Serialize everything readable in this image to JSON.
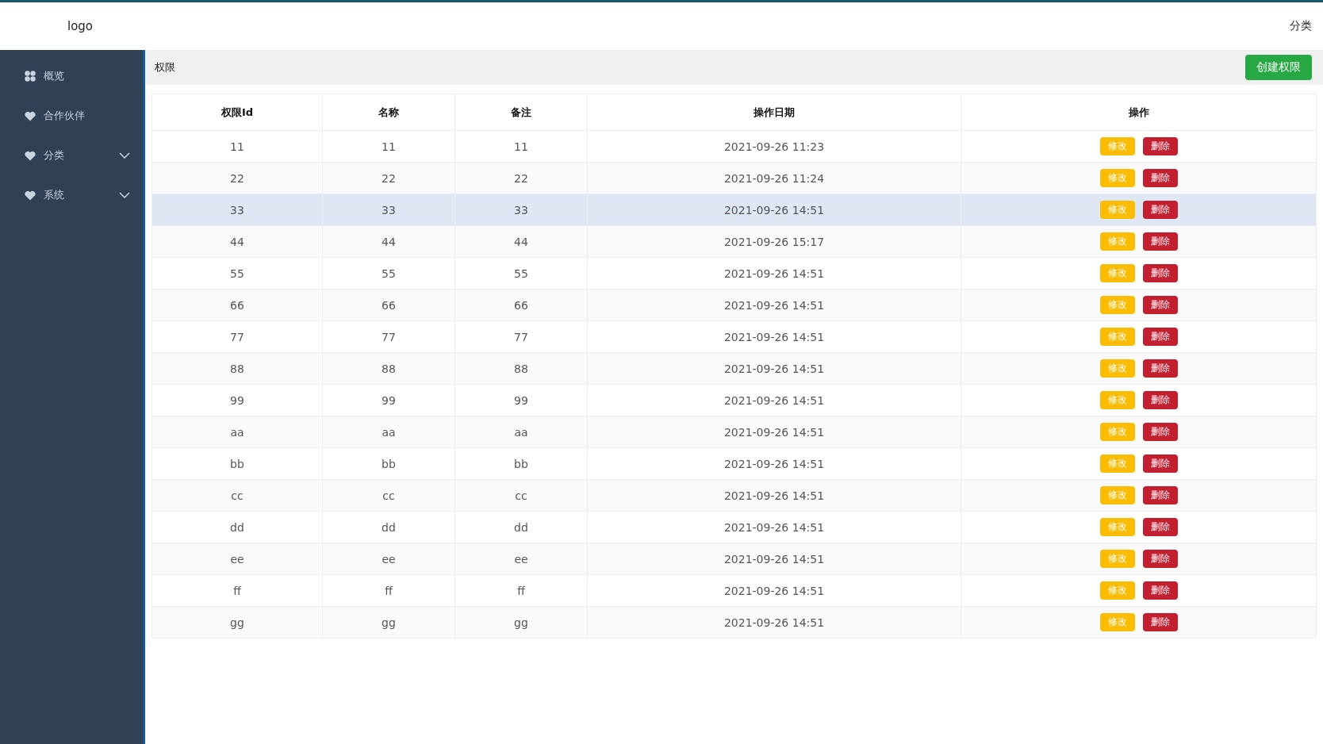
{
  "header": {
    "logo": "logo",
    "right_link": "分类"
  },
  "sidebar": {
    "items": [
      {
        "label": "概览",
        "kind": "link"
      },
      {
        "label": "合作伙伴",
        "kind": "link"
      },
      {
        "label": "分类",
        "kind": "group"
      },
      {
        "label": "系统",
        "kind": "group"
      }
    ]
  },
  "breadcrumb": "权限",
  "create_button": "创建权限",
  "table": {
    "columns": [
      "权限Id",
      "名称",
      "备注",
      "操作日期",
      "操作"
    ],
    "rows": [
      {
        "cells": [
          "11",
          "11",
          "11",
          "2021-09-26 11:23"
        ],
        "highlighted": false,
        "actions": [
          {
            "kind": "edit",
            "label": "修改"
          },
          {
            "kind": "delete",
            "label": "删除"
          }
        ]
      },
      {
        "cells": [
          "22",
          "22",
          "22",
          "2021-09-26 11:24"
        ],
        "highlighted": false,
        "actions": [
          {
            "kind": "edit",
            "label": "修改"
          },
          {
            "kind": "delete",
            "label": "删除"
          }
        ]
      },
      {
        "cells": [
          "33",
          "33",
          "33",
          "2021-09-26 14:51"
        ],
        "highlighted": true,
        "actions": [
          {
            "kind": "edit",
            "label": "修改"
          },
          {
            "kind": "delete",
            "label": "删除"
          }
        ]
      },
      {
        "cells": [
          "44",
          "44",
          "44",
          "2021-09-26 15:17"
        ],
        "highlighted": false,
        "actions": [
          {
            "kind": "edit",
            "label": "修改"
          },
          {
            "kind": "delete",
            "label": "删除"
          }
        ]
      },
      {
        "cells": [
          "55",
          "55",
          "55",
          "2021-09-26 14:51"
        ],
        "highlighted": false,
        "actions": [
          {
            "kind": "edit",
            "label": "修改"
          },
          {
            "kind": "delete",
            "label": "删除"
          }
        ]
      },
      {
        "cells": [
          "66",
          "66",
          "66",
          "2021-09-26 14:51"
        ],
        "highlighted": false,
        "actions": [
          {
            "kind": "edit",
            "label": "修改"
          },
          {
            "kind": "delete",
            "label": "删除"
          }
        ]
      },
      {
        "cells": [
          "77",
          "77",
          "77",
          "2021-09-26 14:51"
        ],
        "highlighted": false,
        "actions": [
          {
            "kind": "edit",
            "label": "修改"
          },
          {
            "kind": "delete",
            "label": "删除"
          }
        ]
      },
      {
        "cells": [
          "88",
          "88",
          "88",
          "2021-09-26 14:51"
        ],
        "highlighted": false,
        "actions": [
          {
            "kind": "edit",
            "label": "修改"
          },
          {
            "kind": "delete",
            "label": "删除"
          }
        ]
      },
      {
        "cells": [
          "99",
          "99",
          "99",
          "2021-09-26 14:51"
        ],
        "highlighted": false,
        "actions": [
          {
            "kind": "edit",
            "label": "修改"
          },
          {
            "kind": "delete",
            "label": "删除"
          }
        ]
      },
      {
        "cells": [
          "aa",
          "aa",
          "aa",
          "2021-09-26 14:51"
        ],
        "highlighted": false,
        "actions": [
          {
            "kind": "edit",
            "label": "修改"
          },
          {
            "kind": "delete",
            "label": "删除"
          }
        ]
      },
      {
        "cells": [
          "bb",
          "bb",
          "bb",
          "2021-09-26 14:51"
        ],
        "highlighted": false,
        "actions": [
          {
            "kind": "edit",
            "label": "修改"
          },
          {
            "kind": "delete",
            "label": "删除"
          }
        ]
      },
      {
        "cells": [
          "cc",
          "cc",
          "cc",
          "2021-09-26 14:51"
        ],
        "highlighted": false,
        "actions": [
          {
            "kind": "edit",
            "label": "修改"
          },
          {
            "kind": "delete",
            "label": "删除"
          }
        ]
      },
      {
        "cells": [
          "dd",
          "dd",
          "dd",
          "2021-09-26 14:51"
        ],
        "highlighted": false,
        "actions": [
          {
            "kind": "edit",
            "label": "修改"
          },
          {
            "kind": "delete",
            "label": "删除"
          }
        ]
      },
      {
        "cells": [
          "ee",
          "ee",
          "ee",
          "2021-09-26 14:51"
        ],
        "highlighted": false,
        "actions": [
          {
            "kind": "edit",
            "label": "修改"
          },
          {
            "kind": "delete",
            "label": "删除"
          }
        ]
      },
      {
        "cells": [
          "ff",
          "ff",
          "ff",
          "2021-09-26 14:51"
        ],
        "highlighted": false,
        "actions": [
          {
            "kind": "edit",
            "label": "修改"
          },
          {
            "kind": "delete",
            "label": "删除"
          }
        ]
      },
      {
        "cells": [
          "gg",
          "gg",
          "gg",
          "2021-09-26 14:51"
        ],
        "highlighted": false,
        "actions": [
          {
            "kind": "edit",
            "label": "修改"
          },
          {
            "kind": "delete",
            "label": "删除"
          }
        ]
      }
    ]
  }
}
